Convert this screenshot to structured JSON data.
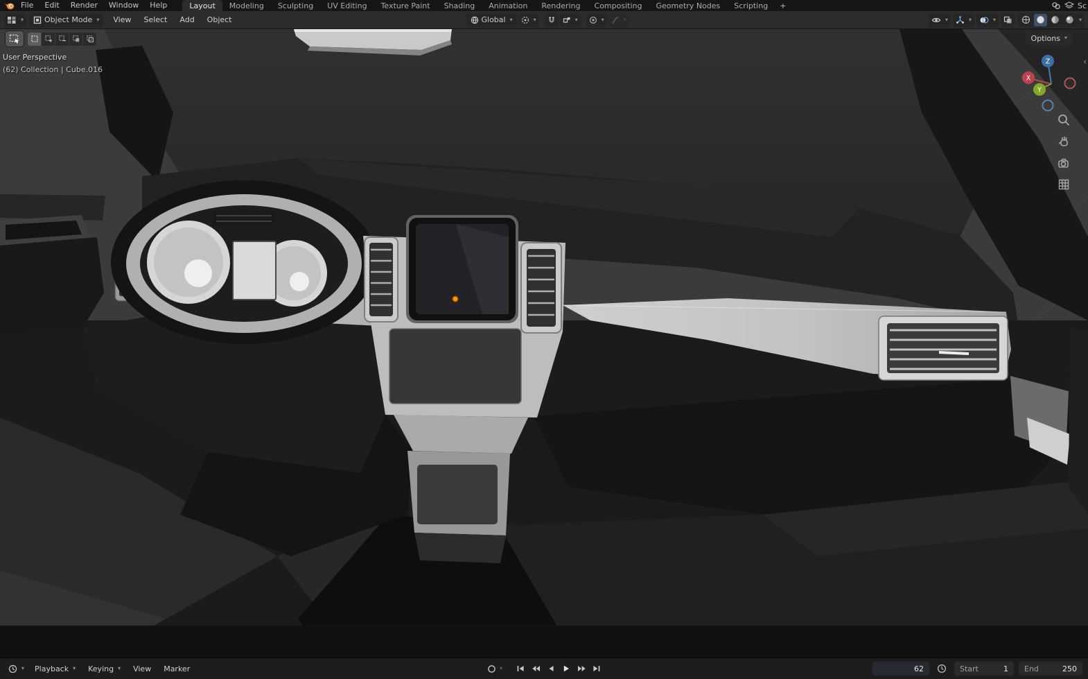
{
  "topbar": {
    "menus": [
      "File",
      "Edit",
      "Render",
      "Window",
      "Help"
    ],
    "tabs": [
      "Layout",
      "Modeling",
      "Sculpting",
      "UV Editing",
      "Texture Paint",
      "Shading",
      "Animation",
      "Rendering",
      "Compositing",
      "Geometry Nodes",
      "Scripting"
    ],
    "active_tab": "Layout",
    "scene_text": "Sc"
  },
  "header": {
    "mode": "Object Mode",
    "menus": [
      "View",
      "Select",
      "Add",
      "Object"
    ],
    "orientation": "Global"
  },
  "tools": {
    "options": "Options"
  },
  "viewport": {
    "view_label": "User Perspective",
    "object_label": "(62) Collection | Cube.016"
  },
  "gizmo": {
    "x": "X",
    "y": "Y",
    "z": "Z"
  },
  "timeline": {
    "playback": "Playback",
    "keying": "Keying",
    "view": "View",
    "marker": "Marker",
    "frame": "62",
    "start_label": "Start",
    "start_value": "1",
    "end_label": "End",
    "end_value": "250"
  },
  "glyphs": {
    "caret": "▾",
    "plus": "+",
    "collapse": "‹"
  },
  "colors": {
    "accent_blue": "#4772b3",
    "origin_orange": "#ff9500",
    "axis_x": "#b8434e",
    "axis_y": "#84a82a",
    "axis_z": "#3f6ea5",
    "grid_green": "#75853f"
  },
  "icons": {
    "blender-logo": "orange blender mark",
    "editor-type": "viewport grid",
    "object-mode": "cursor box",
    "orientation-globe": "globe",
    "pivot-point": "circle dot",
    "snap-magnet": "magnet",
    "proportional-edit": "concentric circles",
    "visibility-eye": "eye",
    "gizmo": "axis arrows",
    "overlays": "overlapping spheres",
    "xray": "overlapping squares",
    "shading": [
      "wireframe-sphere",
      "solid-sphere",
      "material-sphere",
      "rendered-sphere"
    ],
    "transport": [
      "jump-start",
      "prev-keyframe",
      "play-reverse",
      "play",
      "next-keyframe",
      "jump-end"
    ],
    "nav": [
      "zoom",
      "pan-hand",
      "camera-view",
      "toggle-ortho"
    ]
  }
}
